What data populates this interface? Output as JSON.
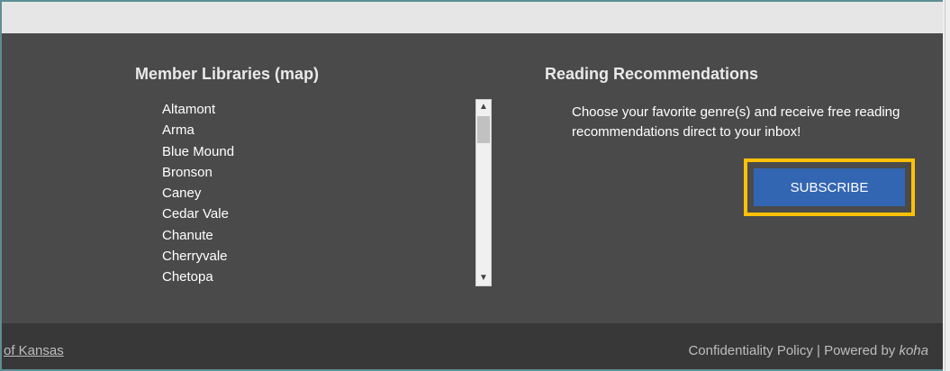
{
  "member_libraries": {
    "title": "Member Libraries (map)",
    "items": [
      "Altamont",
      "Arma",
      "Blue Mound",
      "Bronson",
      "Caney",
      "Cedar Vale",
      "Chanute",
      "Cherryvale",
      "Chetopa"
    ]
  },
  "reading": {
    "title": "Reading Recommendations",
    "description": "Choose your favorite genre(s) and receive free reading recommendations direct to your inbox!",
    "subscribe_label": "SUBSCRIBE"
  },
  "footer": {
    "left_link": "of Kansas",
    "policy_link": "Confidentiality Policy",
    "powered_text": " | Powered by ",
    "koha_link": "koha"
  },
  "colors": {
    "accent": "#ffc107",
    "button": "#3366b2",
    "panel": "#4a4a4a",
    "footer": "#383838"
  },
  "icons": {
    "scroll_up": "chevron-up-icon",
    "scroll_down": "chevron-down-icon"
  }
}
